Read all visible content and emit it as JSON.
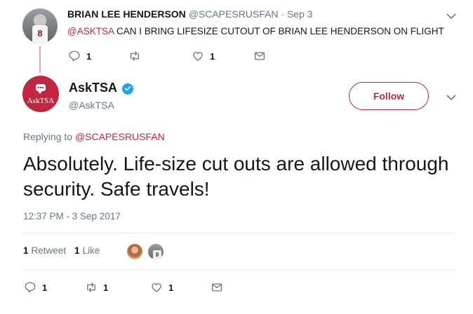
{
  "parent_tweet": {
    "author_name": "BRIAN LEE HENDERSON",
    "author_handle": "@SCAPESRUSFAN",
    "separator": " · ",
    "date": "Sep 3",
    "jersey_number": "8",
    "mention": "@ASKTSA",
    "text": " CAN I BRING LIFESIZE CUTOUT OF BRIAN LEE HENDERSON ON FLIGHT",
    "reply_count": "1",
    "retweet_count": "",
    "like_count": "1"
  },
  "main_tweet": {
    "author_name": "AskTSA",
    "author_handle": "@AskTSA",
    "avatar_label": "AskTSA",
    "follow_label": "Follow",
    "replying_prefix": "Replying to ",
    "replying_to": "@SCAPESRUSFAN",
    "text": "Absolutely. Life-size cut outs are allowed through security. Safe travels!",
    "timestamp": "12:37 PM - 3 Sep 2017",
    "retweets_count": "1",
    "retweets_label": "Retweet",
    "likes_count": "1",
    "likes_label": "Like",
    "liker_jersey_number": "8",
    "reply_count": "1",
    "retweet_count": "1",
    "like_count": "1"
  },
  "colors": {
    "accent": "#c0263e",
    "verified": "#1da1f2",
    "muted_text": "#657786",
    "thread_line": "#e1a4b4"
  },
  "icons": [
    "chevron-down-icon",
    "reply-icon",
    "retweet-icon",
    "like-icon",
    "message-icon",
    "verified-badge-icon",
    "chat-bubble-icon"
  ]
}
